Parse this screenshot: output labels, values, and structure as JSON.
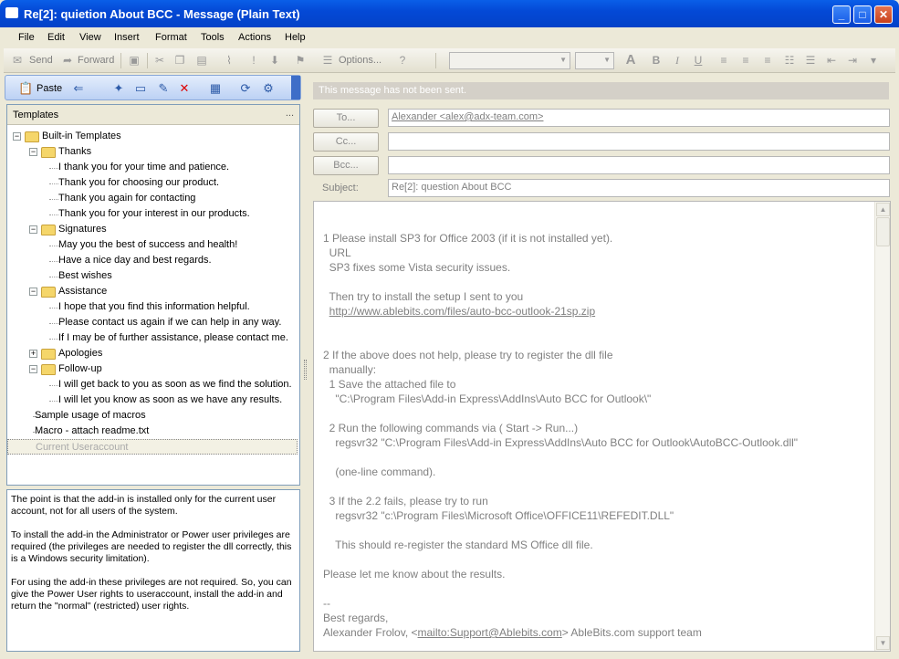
{
  "window": {
    "title": "Re[2]: quietion About BCC - Message (Plain Text)",
    "minimize": "_",
    "maximize": "□",
    "close": "✕"
  },
  "menu": [
    "File",
    "Edit",
    "View",
    "Insert",
    "Format",
    "Tools",
    "Actions",
    "Help"
  ],
  "toolbar": {
    "send": "Send",
    "forward": "Forward",
    "options": "Options..."
  },
  "templates_toolbar": {
    "paste": "Paste"
  },
  "templates": {
    "header": "Templates",
    "header_dots": "...",
    "tree": [
      {
        "label": "Built-in Templates",
        "level": 0,
        "type": "folder",
        "expander": "−"
      },
      {
        "label": "Thanks",
        "level": 1,
        "type": "folder",
        "expander": "−"
      },
      {
        "label": "I thank you for your time and patience.",
        "level": 2,
        "type": "item"
      },
      {
        "label": "Thank you for choosing our product.",
        "level": 2,
        "type": "item"
      },
      {
        "label": "Thank you again for contacting",
        "level": 2,
        "type": "item"
      },
      {
        "label": "Thank you for your interest in our products.",
        "level": 2,
        "type": "item"
      },
      {
        "label": "Signatures",
        "level": 1,
        "type": "folder",
        "expander": "−"
      },
      {
        "label": "May you the best of success and health!",
        "level": 2,
        "type": "item"
      },
      {
        "label": "Have a nice day and best regards.",
        "level": 2,
        "type": "item"
      },
      {
        "label": "Best wishes",
        "level": 2,
        "type": "item"
      },
      {
        "label": "Assistance",
        "level": 1,
        "type": "folder",
        "expander": "−"
      },
      {
        "label": "I hope that you find this information helpful.",
        "level": 2,
        "type": "item"
      },
      {
        "label": "Please contact us again if we can help in any way.",
        "level": 2,
        "type": "item"
      },
      {
        "label": "If I may be of further assistance, please contact me.",
        "level": 2,
        "type": "item"
      },
      {
        "label": "Apologies",
        "level": 1,
        "type": "folder",
        "expander": "+"
      },
      {
        "label": "Follow-up",
        "level": 1,
        "type": "folder",
        "expander": "−"
      },
      {
        "label": "I will get back to you as soon as we find the solution.",
        "level": 2,
        "type": "item"
      },
      {
        "label": "I will let you know as soon as we have any results.",
        "level": 2,
        "type": "item"
      },
      {
        "label": "Sample usage of macros",
        "level": 1,
        "type": "item"
      },
      {
        "label": "Macro - attach readme.txt",
        "level": 1,
        "type": "item"
      },
      {
        "label": "Current Useraccount",
        "level": 1,
        "type": "item",
        "selected": true
      }
    ]
  },
  "description": [
    "The point is that the add-in is installed only for the current user account, not for all users of the system.",
    "To install the add-in the Administrator or Power user privileges are required (the privileges are needed to register the dll correctly, this is a Windows security limitation).",
    "For using the add-in these privileges are not required. So, you can give the Power User rights to useraccount, install the add-in and return the \"normal\" (restricted) user rights."
  ],
  "message": {
    "info": "This message has not been sent.",
    "to_label": "To...",
    "to_value": "Alexander <alex@adx-team.com>",
    "cc_label": "Cc...",
    "cc_value": "",
    "bcc_label": "Bcc...",
    "bcc_value": "",
    "subject_label": "Subject:",
    "subject_value": "Re[2]: question About BCC",
    "body_lines": [
      "1 Please install SP3 for Office 2003 (if it is not installed yet).",
      "  URL",
      "  SP3 fixes some Vista security issues.",
      "",
      "  Then try to install the setup I sent to you",
      "  http://www.ablebits.com/files/auto-bcc-outlook-21sp.zip",
      "",
      "",
      "2 If the above does not help, please try to register the dll file",
      "  manually:",
      "  1 Save the attached file to",
      "    \"C:\\Program Files\\Add-in Express\\AddIns\\Auto BCC for Outlook\\\"",
      "",
      "  2 Run the following commands via ( Start -> Run...)",
      "    regsvr32 \"C:\\Program Files\\Add-in Express\\AddIns\\Auto BCC for Outlook\\AutoBCC-Outlook.dll\"",
      "",
      "    (one-line command).",
      "",
      "  3 If the 2.2 fails, please try to run",
      "    regsvr32 \"c:\\Program Files\\Microsoft Office\\OFFICE11\\REFEDIT.DLL\"",
      "",
      "    This should re-register the standard MS Office dll file.",
      "",
      "Please let me know about the results.",
      "",
      "--",
      "Best regards,",
      "Alexander Frolov, <mailto:Support@Ablebits.com> AbleBits.com support team"
    ]
  }
}
